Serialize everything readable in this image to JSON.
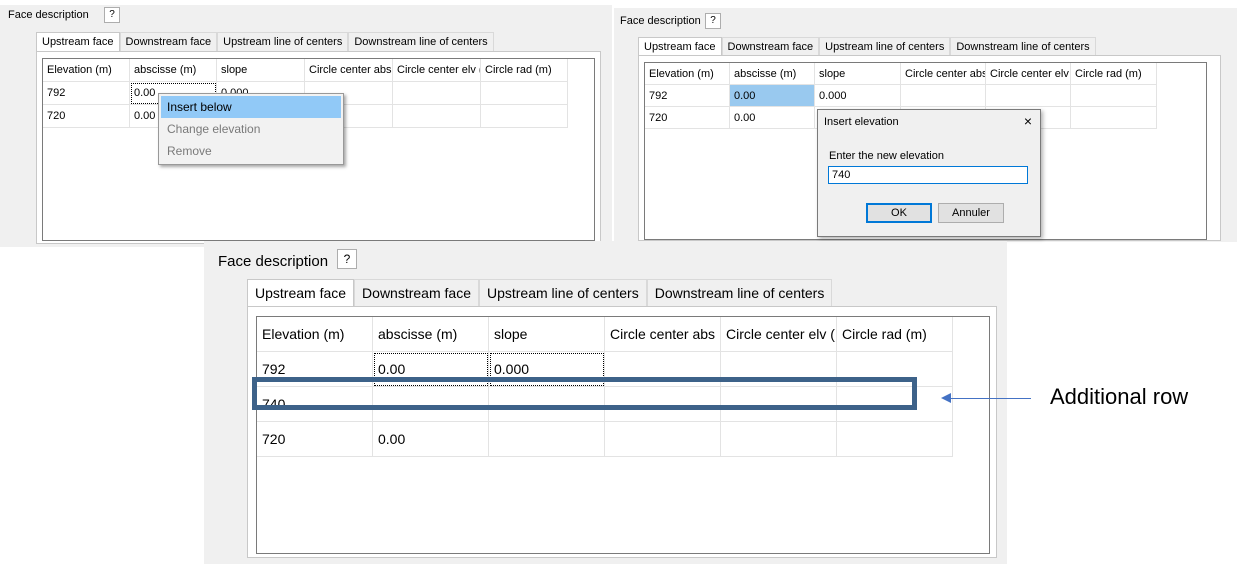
{
  "panels": [
    {
      "title": "Face description",
      "help_label": "?",
      "tabs": [
        "Upstream face",
        "Downstream face",
        "Upstream line of centers",
        "Downstream line of centers"
      ],
      "columns": [
        "Elevation (m)",
        "abscisse (m)",
        "slope",
        "Circle center abs",
        "Circle center elv (",
        "Circle  rad (m)"
      ],
      "rows": [
        [
          "792",
          "0.00",
          "0.000",
          "",
          "",
          ""
        ],
        [
          "720",
          "0.00",
          "",
          "",
          "",
          ""
        ]
      ]
    },
    {
      "title": "Face description",
      "help_label": "?",
      "tabs": [
        "Upstream face",
        "Downstream face",
        "Upstream line of centers",
        "Downstream line of centers"
      ],
      "columns": [
        "Elevation (m)",
        "abscisse (m)",
        "slope",
        "Circle center abs",
        "Circle center elv (",
        "Circle  rad (m)"
      ],
      "rows": [
        [
          "792",
          "0.00",
          "0.000",
          "",
          "",
          ""
        ],
        [
          "720",
          "0.00",
          "",
          "",
          "",
          ""
        ]
      ]
    },
    {
      "title": "Face description",
      "help_label": "?",
      "tabs": [
        "Upstream face",
        "Downstream face",
        "Upstream line of centers",
        "Downstream line of centers"
      ],
      "columns": [
        "Elevation (m)",
        "abscisse (m)",
        "slope",
        "Circle center abs",
        "Circle center elv (",
        "Circle  rad (m)"
      ],
      "rows": [
        [
          "792",
          "0.00",
          "0.000",
          "",
          "",
          ""
        ],
        [
          "740",
          "",
          "",
          "",
          "",
          ""
        ],
        [
          "720",
          "0.00",
          "",
          "",
          "",
          ""
        ]
      ]
    }
  ],
  "context_menu": {
    "items": [
      "Insert below",
      "Change elevation",
      "Remove"
    ]
  },
  "dialog": {
    "title": "Insert elevation",
    "close": "×",
    "prompt": "Enter the new elevation",
    "value": "740",
    "ok": "OK",
    "cancel": "Annuler"
  },
  "annotation": {
    "label": "Additional row",
    "color": "#4472c4",
    "box_color": "#3d6289"
  }
}
